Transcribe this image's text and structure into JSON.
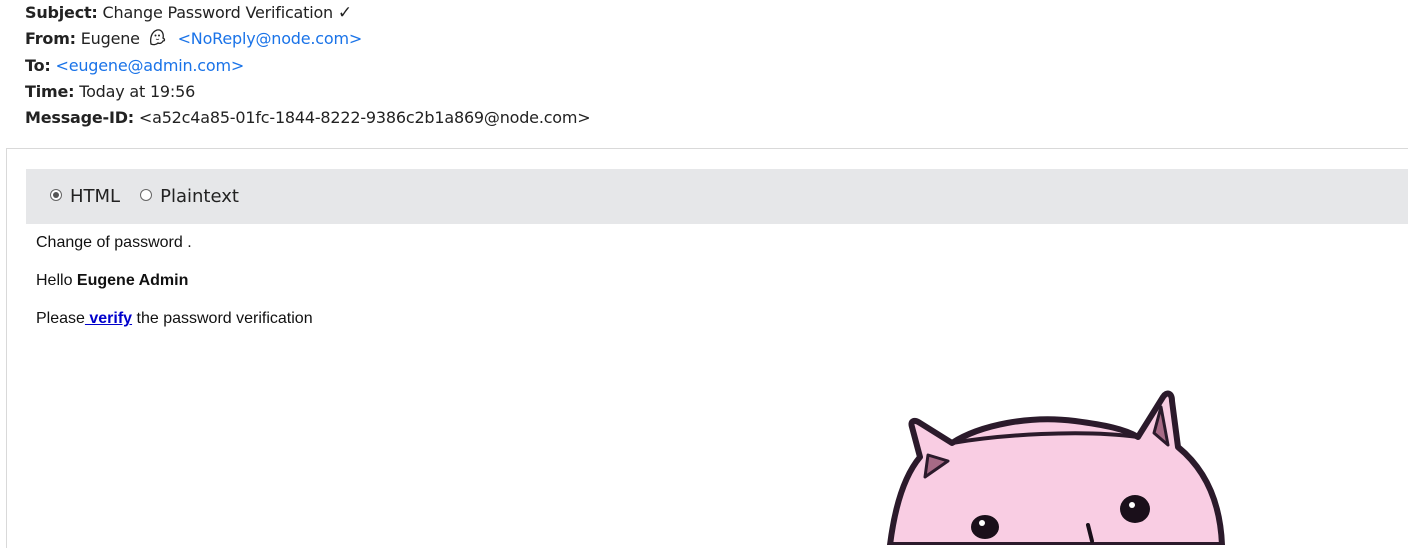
{
  "headers": {
    "subject_label": "Subject:",
    "subject_value": "Change Password Verification",
    "subject_check": "✓",
    "from_label": "From:",
    "from_name": "Eugene",
    "from_icon": "ghost-icon",
    "from_email": "<NoReply@node.com>",
    "to_label": "To:",
    "to_email": "<eugene@admin.com>",
    "time_label": "Time:",
    "time_value": "Today at 19:56",
    "message_id_label": "Message-ID:",
    "message_id_value": "<a52c4a85-01fc-1844-8222-9386c2b1a869@node.com>"
  },
  "view_toggle": {
    "options": [
      {
        "label": "HTML",
        "selected": true
      },
      {
        "label": "Plaintext",
        "selected": false
      }
    ]
  },
  "message": {
    "line1": "Change of password .",
    "greeting_prefix": "Hello",
    "greeting_name": "Eugene Admin",
    "line3_prefix": "Please",
    "verify_link": " verify",
    "line3_suffix": " the password verification"
  },
  "colors": {
    "link_blue": "#1a73e8",
    "verify_link": "#0000cc",
    "toolbar_bg": "#e6e7e9",
    "cat_pink": "#f9cde3",
    "cat_outline": "#2b1a2b"
  }
}
